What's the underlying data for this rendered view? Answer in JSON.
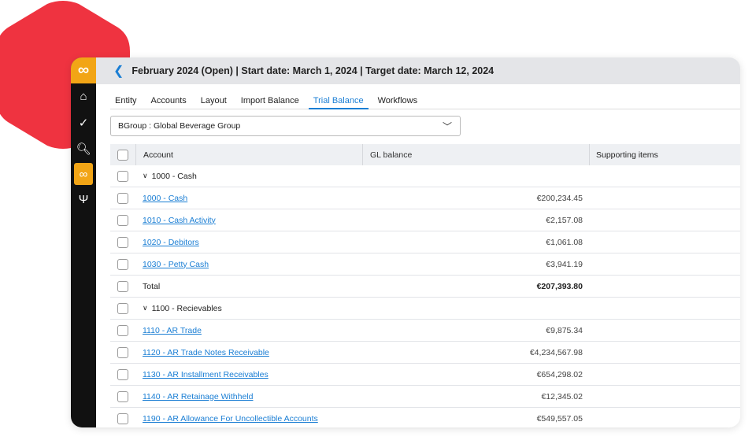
{
  "header": {
    "title": "February 2024 (Open) | Start date: March 1, 2024 | Target date: March 12, 2024"
  },
  "tabs": [
    {
      "label": "Entity"
    },
    {
      "label": "Accounts"
    },
    {
      "label": "Layout"
    },
    {
      "label": "Import Balance"
    },
    {
      "label": "Trial Balance",
      "active": true
    },
    {
      "label": "Workflows"
    }
  ],
  "entity_select": {
    "value": "BGroup : Global Beverage Group"
  },
  "table": {
    "columns": [
      "Account",
      "GL balance",
      "Supporting items"
    ],
    "groups": [
      {
        "label": "1000 - Cash",
        "rows": [
          {
            "account": "1000 - Cash",
            "balance": "€200,234.45"
          },
          {
            "account": "1010 - Cash Activity",
            "balance": "€2,157.08"
          },
          {
            "account": "1020 - Debitors",
            "balance": "€1,061.08"
          },
          {
            "account": "1030 - Petty Cash",
            "balance": "€3,941.19"
          }
        ],
        "total_label": "Total",
        "total": "€207,393.80"
      },
      {
        "label": "1100 - Recievables",
        "rows": [
          {
            "account": "1110 - AR Trade",
            "balance": "€9,875.34"
          },
          {
            "account": "1120 - AR Trade Notes Receivable",
            "balance": "€4,234,567.98"
          },
          {
            "account": "1130 - AR Installment Receivables",
            "balance": "€654,298.02"
          },
          {
            "account": "1140 - AR Retainage Withheld",
            "balance": "€12,345.02"
          },
          {
            "account": "1190 - AR Allowance For Uncollectible Accounts",
            "balance": "€549,557.05"
          }
        ]
      }
    ]
  },
  "sidebar": {
    "items": [
      "home-icon",
      "check-circle-icon",
      "search-document-icon",
      "infinity-icon",
      "workflow-icon"
    ],
    "active": "infinity-icon"
  },
  "colors": {
    "accent": "#1a7ed4",
    "brand": "#f2a516",
    "decor": "#ef3340",
    "sidebar": "#111111"
  }
}
